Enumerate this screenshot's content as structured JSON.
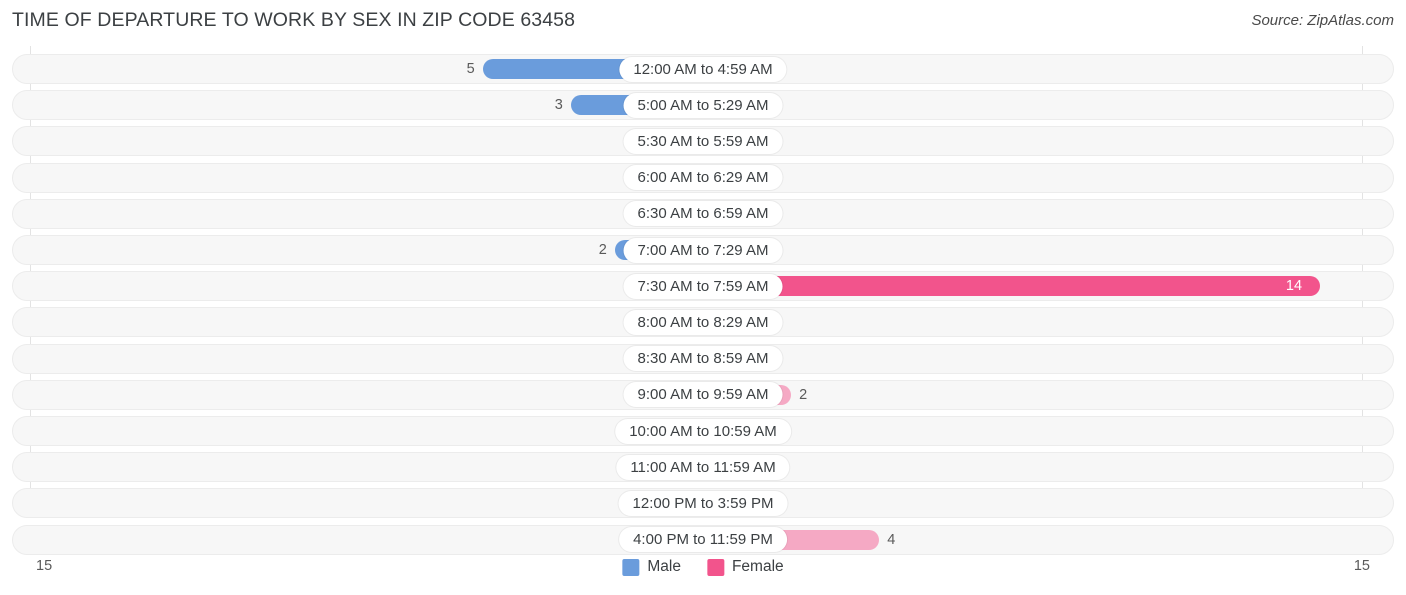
{
  "header": {
    "title": "TIME OF DEPARTURE TO WORK BY SEX IN ZIP CODE 63458",
    "source": "Source: ZipAtlas.com"
  },
  "legend": {
    "male_label": "Male",
    "female_label": "Female",
    "male_color": "#6a9cdc",
    "female_color": "#f2548c"
  },
  "axis": {
    "left_max_label": "15",
    "right_max_label": "15"
  },
  "colors": {
    "male": "#6a9cdc",
    "male_zero": "#a9c9ec",
    "female": "#f5a9c4",
    "female_max": "#f2548c",
    "track": "#f7f7f7",
    "gridline": "#e3e3e3"
  },
  "chart_data": {
    "type": "bar",
    "title": "TIME OF DEPARTURE TO WORK BY SEX IN ZIP CODE 63458",
    "subtitle": "Source: ZipAtlas.com",
    "orientation": "horizontal-diverging",
    "xlabel": "",
    "ylabel": "",
    "xlim": [
      15,
      15
    ],
    "grid": true,
    "legend_position": "bottom-center",
    "categories": [
      "12:00 AM to 4:59 AM",
      "5:00 AM to 5:29 AM",
      "5:30 AM to 5:59 AM",
      "6:00 AM to 6:29 AM",
      "6:30 AM to 6:59 AM",
      "7:00 AM to 7:29 AM",
      "7:30 AM to 7:59 AM",
      "8:00 AM to 8:29 AM",
      "8:30 AM to 8:59 AM",
      "9:00 AM to 9:59 AM",
      "10:00 AM to 10:59 AM",
      "11:00 AM to 11:59 AM",
      "12:00 PM to 3:59 PM",
      "4:00 PM to 11:59 PM"
    ],
    "series": [
      {
        "name": "Male",
        "values": [
          5,
          3,
          0,
          0,
          0,
          2,
          0,
          0,
          0,
          0,
          0,
          0,
          0,
          0
        ],
        "labels": [
          "5",
          "3",
          "0",
          "0",
          "0",
          "2",
          "0",
          "0",
          "0",
          "0",
          "0",
          "0",
          "0",
          "0"
        ]
      },
      {
        "name": "Female",
        "values": [
          0,
          0,
          0,
          0,
          0,
          1,
          14,
          0,
          0,
          2,
          1,
          0,
          0,
          4
        ],
        "labels": [
          "0",
          "0",
          "0",
          "0",
          "0",
          "1",
          "14",
          "0",
          "0",
          "2",
          "1",
          "0",
          "0",
          "4"
        ]
      }
    ]
  }
}
